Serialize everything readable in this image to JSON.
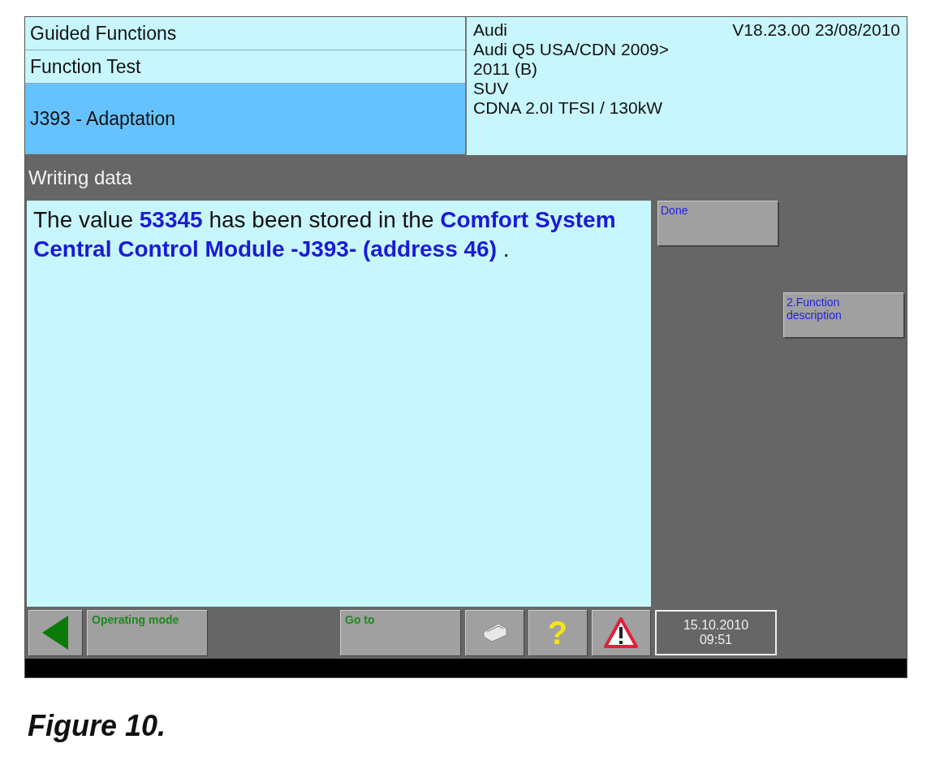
{
  "header": {
    "path": [
      {
        "label": "Guided Functions",
        "selected": false
      },
      {
        "label": "Function Test",
        "selected": false
      },
      {
        "label": "J393 - Adaptation",
        "selected": true
      }
    ],
    "vehicle": {
      "brand": "Audi",
      "version": "V18.23.00 23/08/2010",
      "lines": [
        "Audi Q5 USA/CDN 2009>",
        "2011 (B)",
        "SUV",
        "CDNA 2.0I TFSI / 130kW"
      ]
    }
  },
  "section_title": "Writing data",
  "message": "The value **53345** has been stored in the **Comfort System Central Control Module -J393- (address 46)** .",
  "side_buttons": [
    {
      "label": "Done"
    },
    {
      "label": "2.Function description"
    }
  ],
  "toolbar": {
    "buttons": [
      {
        "kind": "back"
      },
      {
        "kind": "text",
        "label": "Operating mode"
      },
      {
        "kind": "spacer"
      },
      {
        "kind": "text",
        "label": "Go to"
      },
      {
        "kind": "printer"
      },
      {
        "kind": "help",
        "label": "?"
      },
      {
        "kind": "warning"
      }
    ],
    "date": "15.10.2010",
    "time": "09:51"
  },
  "caption": "Figure 10."
}
